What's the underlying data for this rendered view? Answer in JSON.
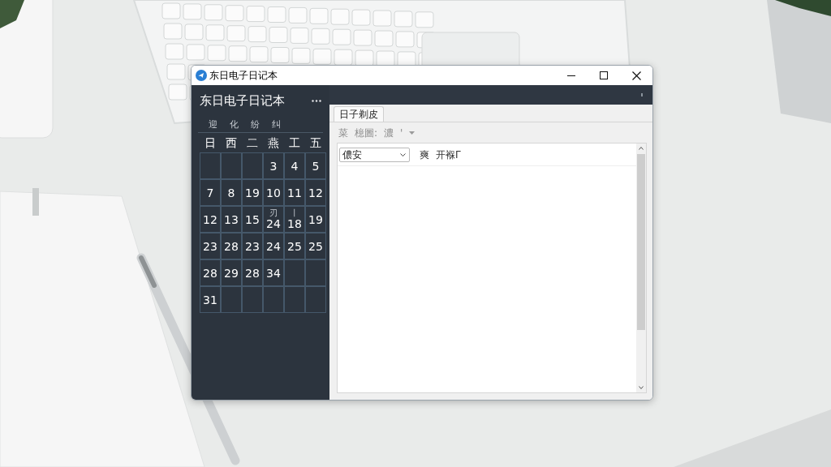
{
  "window": {
    "title": "东日电子日记本"
  },
  "sidebar": {
    "title": "东日电子日记本",
    "filters": [
      "迎",
      "化",
      "纷",
      "纠"
    ],
    "weekdays": [
      "日",
      "西",
      "二",
      "燕",
      "工",
      "五"
    ],
    "weeks": [
      [
        {
          "kind": "blank"
        },
        {
          "kind": "blank"
        },
        {
          "kind": "blank"
        },
        {
          "kind": "date",
          "day": "3"
        },
        {
          "kind": "date",
          "day": "4"
        },
        {
          "kind": "date",
          "day": "5"
        }
      ],
      [
        {
          "kind": "date",
          "day": "7"
        },
        {
          "kind": "date",
          "day": "8"
        },
        {
          "kind": "date",
          "day": "19"
        },
        {
          "kind": "date",
          "day": "10"
        },
        {
          "kind": "date",
          "day": "11"
        },
        {
          "kind": "date",
          "day": "12"
        }
      ],
      [
        {
          "kind": "date",
          "day": "12"
        },
        {
          "kind": "date",
          "day": "13"
        },
        {
          "kind": "date",
          "day": "15"
        },
        {
          "kind": "date",
          "day": "24",
          "note": "刃"
        },
        {
          "kind": "date",
          "day": "18",
          "note": "丨"
        },
        {
          "kind": "date",
          "day": "19"
        }
      ],
      [
        {
          "kind": "date",
          "day": "23"
        },
        {
          "kind": "date",
          "day": "28"
        },
        {
          "kind": "date",
          "day": "23"
        },
        {
          "kind": "date",
          "day": "24"
        },
        {
          "kind": "date",
          "day": "25"
        },
        {
          "kind": "date",
          "day": "25"
        }
      ],
      [
        {
          "kind": "date",
          "day": "28"
        },
        {
          "kind": "date",
          "day": "29"
        },
        {
          "kind": "date",
          "day": "28"
        },
        {
          "kind": "date",
          "day": "34"
        },
        {
          "kind": "blank"
        },
        {
          "kind": "blank"
        }
      ],
      [
        {
          "kind": "date",
          "day": "31"
        },
        {
          "kind": "blank"
        },
        {
          "kind": "blank"
        },
        {
          "kind": "blank"
        },
        {
          "kind": "blank"
        },
        {
          "kind": "blank"
        }
      ]
    ]
  },
  "editor": {
    "tabs": [
      {
        "label": "日子剃皮",
        "selected": true
      }
    ],
    "toolbar": [
      "菜",
      "檍圖:",
      "濃",
      "'"
    ],
    "dropdown": {
      "value": "儂安"
    },
    "labels": [
      "爽",
      "开褓Γ"
    ]
  }
}
